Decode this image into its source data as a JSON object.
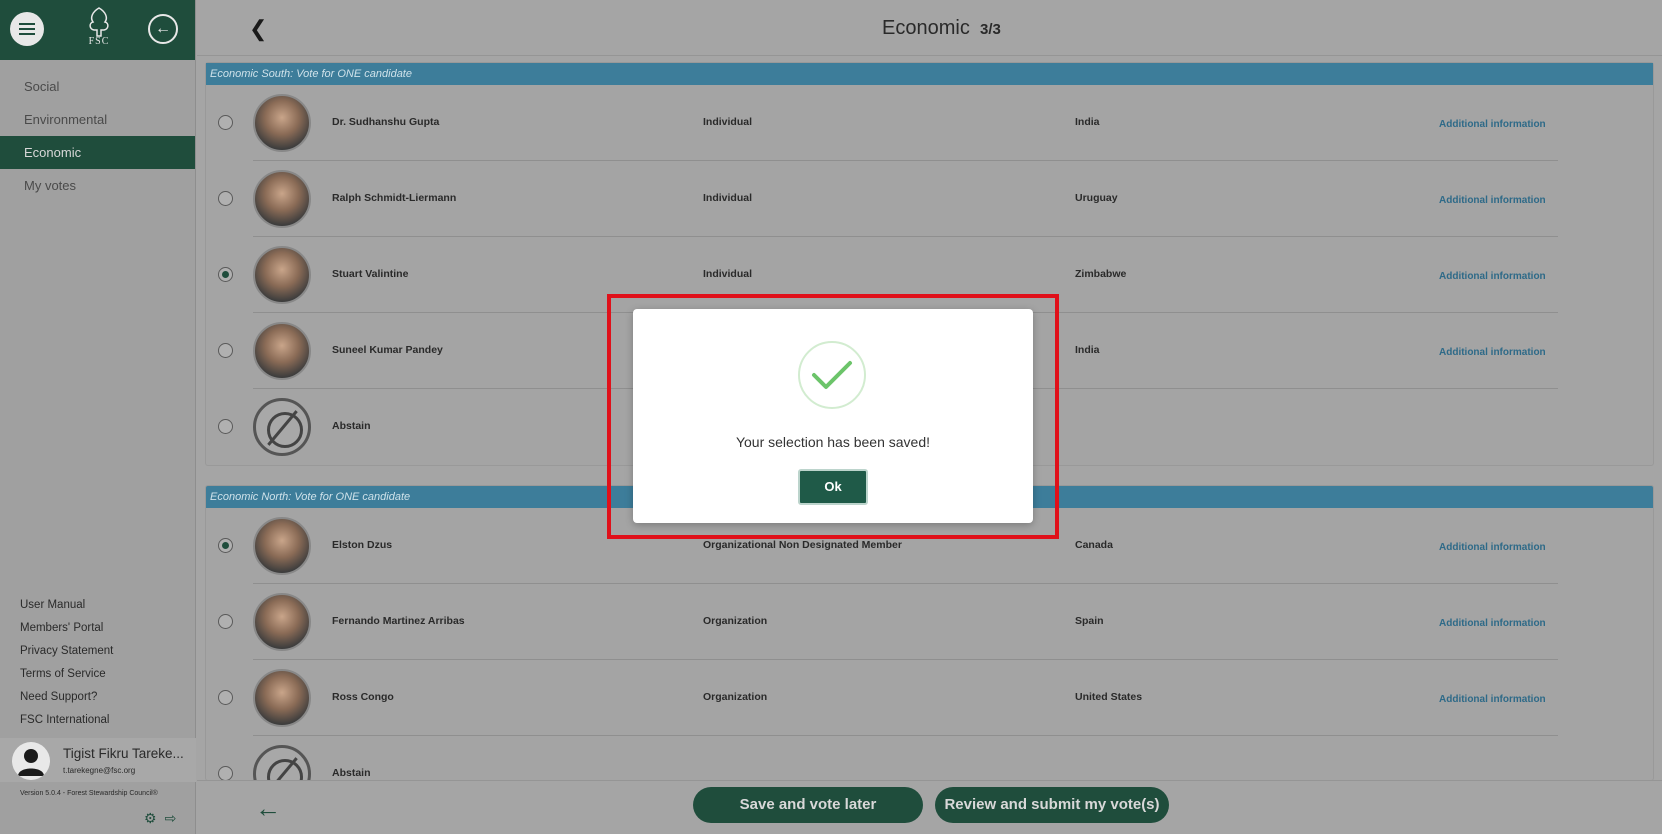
{
  "sidebar": {
    "logo_text": "FSC",
    "nav": [
      {
        "label": "Social"
      },
      {
        "label": "Environmental"
      },
      {
        "label": "Economic",
        "active": true
      },
      {
        "label": "My votes"
      }
    ],
    "links": [
      "User Manual",
      "Members' Portal",
      "Privacy Statement",
      "Terms of Service",
      "Need Support?",
      "FSC International"
    ],
    "user": {
      "name": "Tigist Fikru Tareke...",
      "email": "t.tarekegne@fsc.org"
    },
    "version": "Version 5.0.4 - Forest Stewardship Council®"
  },
  "header": {
    "title": "Economic",
    "count": "3/3"
  },
  "sections": [
    {
      "title": "Economic South: Vote for ONE candidate",
      "rows": [
        {
          "name": "Dr. Sudhanshu Gupta",
          "type": "Individual",
          "country": "India",
          "info": "Additional information",
          "selected": false
        },
        {
          "name": "Ralph Schmidt-Liermann",
          "type": "Individual",
          "country": "Uruguay",
          "info": "Additional information",
          "selected": false
        },
        {
          "name": "Stuart Valintine",
          "type": "Individual",
          "country": "Zimbabwe",
          "info": "Additional information",
          "selected": true
        },
        {
          "name": "Suneel Kumar Pandey",
          "type": "",
          "country": "India",
          "info": "Additional information",
          "selected": false
        },
        {
          "name": "Abstain",
          "type": "",
          "country": "",
          "info": "",
          "selected": false,
          "abstain": true
        }
      ]
    },
    {
      "title": "Economic North: Vote for ONE candidate",
      "rows": [
        {
          "name": "Elston Dzus",
          "type": "Organizational Non Designated Member",
          "country": "Canada",
          "info": "Additional information",
          "selected": true
        },
        {
          "name": "Fernando Martinez Arribas",
          "type": "Organization",
          "country": "Spain",
          "info": "Additional information",
          "selected": false
        },
        {
          "name": "Ross Congo",
          "type": "Organization",
          "country": "United States",
          "info": "Additional information",
          "selected": false
        },
        {
          "name": "Abstain",
          "type": "",
          "country": "",
          "info": "",
          "selected": false,
          "abstain": true
        }
      ]
    }
  ],
  "footer": {
    "save_label": "Save and vote later",
    "review_label": "Review and submit my vote(s)"
  },
  "modal": {
    "message": "Your selection has been saved!",
    "ok_label": "Ok"
  },
  "colors": {
    "brand": "#1f4d3c",
    "section_header": "#3d7d9a",
    "link": "#2e6a88",
    "highlight": "#e0101a",
    "check": "#6cc46a"
  }
}
